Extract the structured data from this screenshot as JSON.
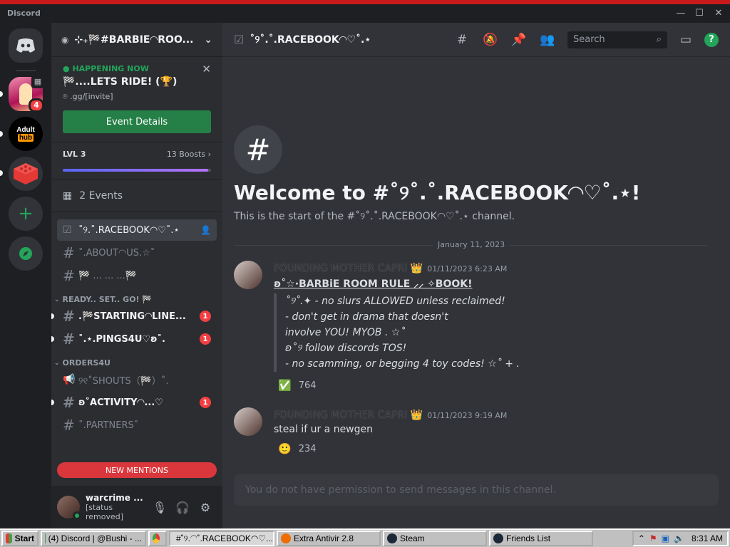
{
  "titlebar": {
    "brand": "Discord"
  },
  "servers": {
    "badge_count": "4",
    "server2_label_top": "Adult",
    "server2_label_bottom": "hub"
  },
  "sidebar": {
    "server_name": "⊹₊🏁#BARBIE◠ROO...",
    "event": {
      "status": "HAPPENING NOW",
      "title": "🏁....LETS RIDE! (🏆)",
      "location": ".gg/[invite]",
      "button": "Event Details"
    },
    "boost": {
      "level": "LVL 3",
      "boosts": "13 Boosts",
      "progress": 0.98
    },
    "events_label": "2 Events",
    "channels_top": [
      {
        "label": "˚୨.˚.RACEBOOK◠♡˚.⋆",
        "active": true
      },
      {
        "label": "˚.ABOUT◠US.☆˚"
      },
      {
        "label": "🏁 ... ... ...🏁"
      }
    ],
    "category1": "READY.. SET.. GO! 🏁",
    "channels_cat1": [
      {
        "label": ".🏁STARTING◠LINE...",
        "badge": "1"
      },
      {
        "label": "˚.⋆.PINGS4U♡ʚ˚.",
        "badge": "1"
      }
    ],
    "category2": "ORDERS4U",
    "channels_cat2": [
      {
        "label": "୨୧˚SHOUTS（🏁）˚."
      },
      {
        "label": "ʚ˚ACTIVITY◠...♡",
        "badge": "1"
      },
      {
        "label": "˚.PARTNERS˚"
      }
    ],
    "new_mentions": "NEW MENTIONS",
    "user": {
      "name": "warcrime ...",
      "status": "[status removed]"
    }
  },
  "main": {
    "channel_title": "˚୨˚.˚.RACEBOOK◠♡˚.⋆",
    "search_placeholder": "Search",
    "welcome_title": "Welcome to #˚୨˚.˚.RACEBOOK◠♡˚.⋆!",
    "welcome_sub": "This is the start of the #˚୨˚.˚.RACEBOOK◠♡˚.⋆ channel.",
    "date_divider": "January 11, 2023",
    "messages": [
      {
        "author": "FOUNDING MOTHER CAPRI 👑",
        "timestamp": "01/11/2023 6:23 AM",
        "heading": "ʚ˚☆·BARBiE ROOM RULE ⸝⸝ ✧BOOK!",
        "quote": [
          "˚୨˚.✦ - no slurs ALLOWED unless reclaimed!",
          "- don't get in drama that doesn't",
          "involve YOU! MYOB . ☆˚",
          "ʚ˚୨ follow discords TOS!",
          "- no scamming, or begging 4 toy codes! ☆˚ + ."
        ],
        "reaction_emoji": "✅",
        "reaction_count": "764"
      },
      {
        "author": "FOUNDING MOTHER CAPRI 👑",
        "timestamp": "01/11/2023 9:19 AM",
        "text": "steal if ur a newgen",
        "reaction_emoji": "🙂",
        "reaction_count": "234"
      }
    ],
    "composer_placeholder": "You do not have permission to send messages in this channel."
  },
  "taskbar": {
    "start": "Start",
    "tasks": [
      "(4) Discord | @Bushi - ...",
      "#˚୨.◠˚.RACEBOOK◠♡...",
      "Extra Antivir 2.8",
      "Steam",
      "Friends List"
    ],
    "clock": "8:31 AM"
  }
}
